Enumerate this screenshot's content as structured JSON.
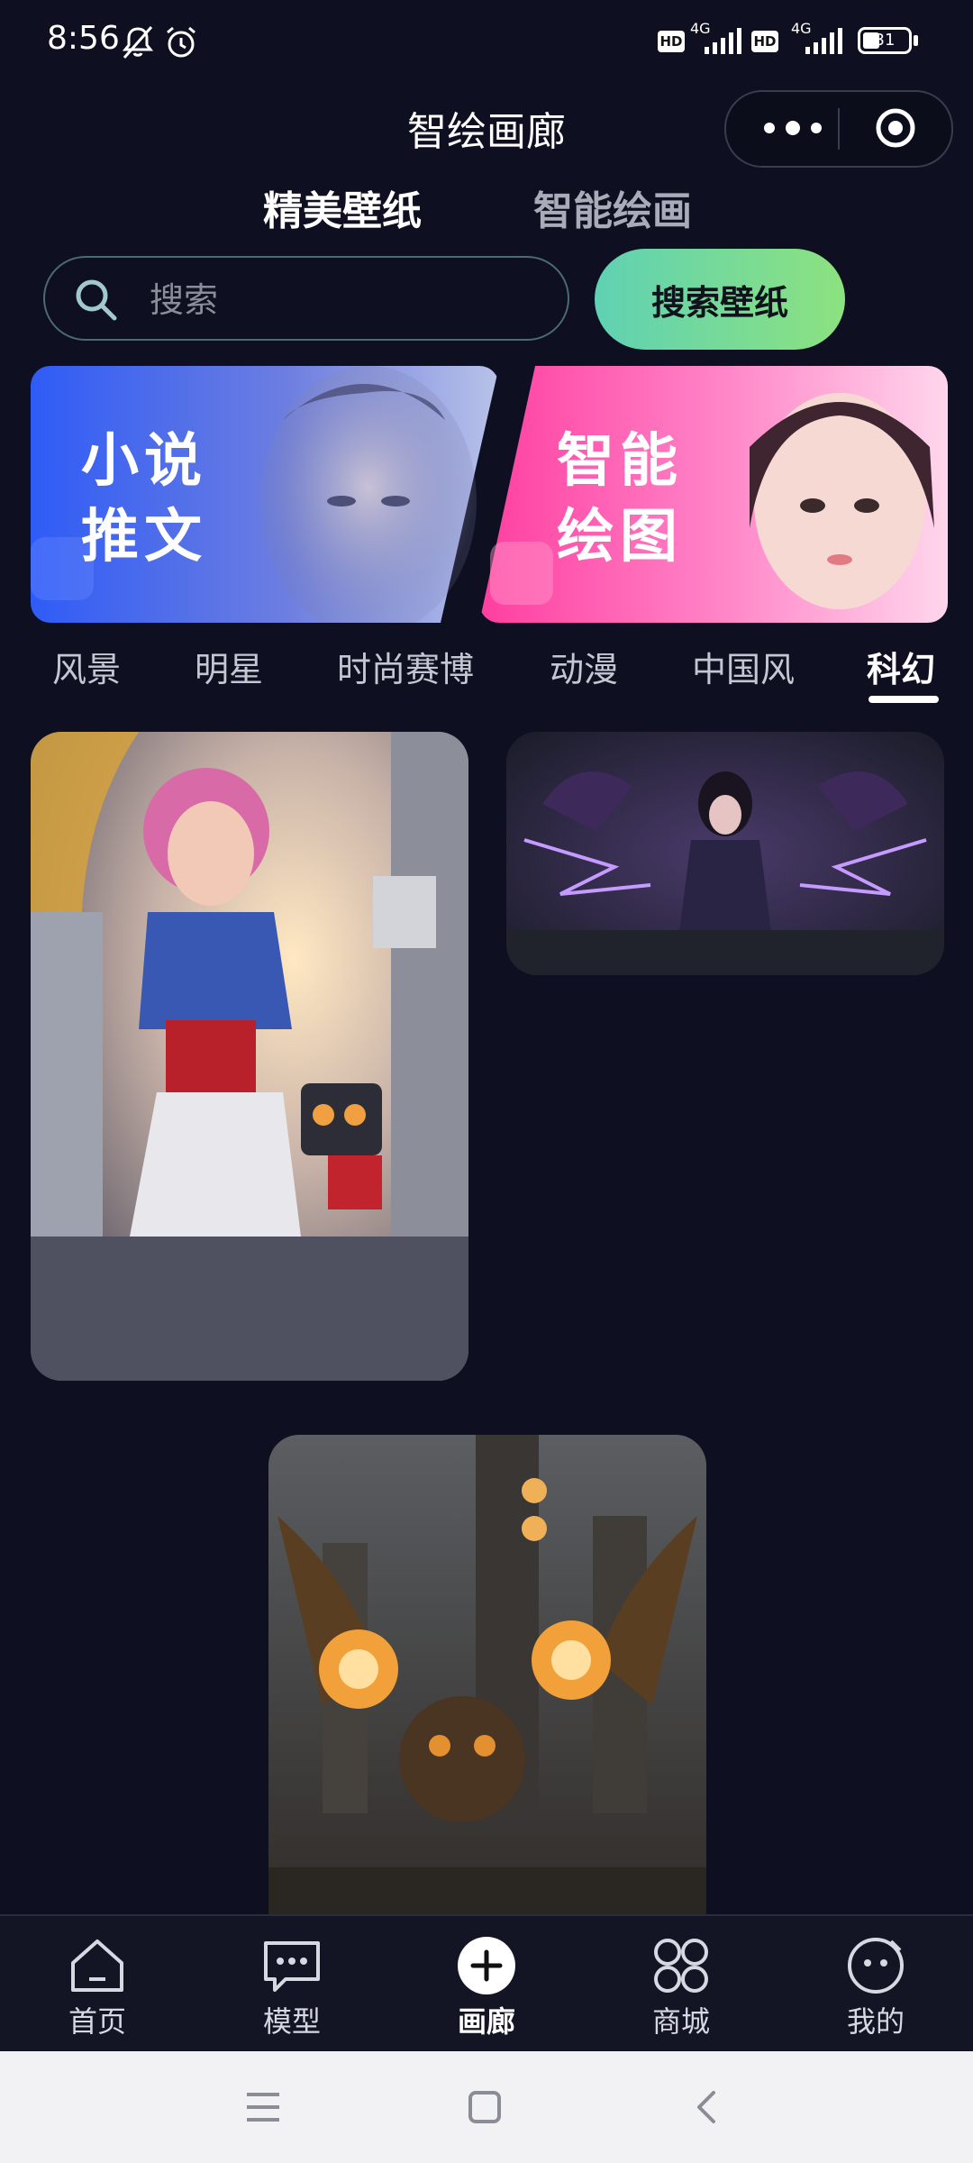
{
  "status_bar": {
    "time": "8:56",
    "hd1": "HD",
    "net1": "4G",
    "hd2": "HD",
    "net2": "4G",
    "battery": "31"
  },
  "header": {
    "title": "智绘画廊"
  },
  "segments": [
    {
      "label": "精美壁纸",
      "active": true
    },
    {
      "label": "智能绘画",
      "active": false
    }
  ],
  "search": {
    "placeholder": "搜索",
    "value": "",
    "button_label": "搜索壁纸"
  },
  "banners": [
    {
      "line1": "小说",
      "line2": "推文"
    },
    {
      "line1": "智能",
      "line2": "绘图"
    }
  ],
  "categories": [
    {
      "label": "风景",
      "active": false
    },
    {
      "label": "明星",
      "active": false
    },
    {
      "label": "时尚赛博",
      "active": false
    },
    {
      "label": "动漫",
      "active": false
    },
    {
      "label": "中国风",
      "active": false
    },
    {
      "label": "科幻",
      "active": true
    }
  ],
  "bottom_nav": [
    {
      "label": "首页",
      "icon": "home-icon"
    },
    {
      "label": "模型",
      "icon": "chat-bubble-icon"
    },
    {
      "label": "画廊",
      "icon": "plus-circle-icon",
      "active": true
    },
    {
      "label": "商城",
      "icon": "grid-icon"
    },
    {
      "label": "我的",
      "icon": "smiley-icon"
    }
  ],
  "colors": {
    "background": "#0e0f20",
    "accent_green": "#8ce27f",
    "accent_teal": "#5fd1b3"
  }
}
